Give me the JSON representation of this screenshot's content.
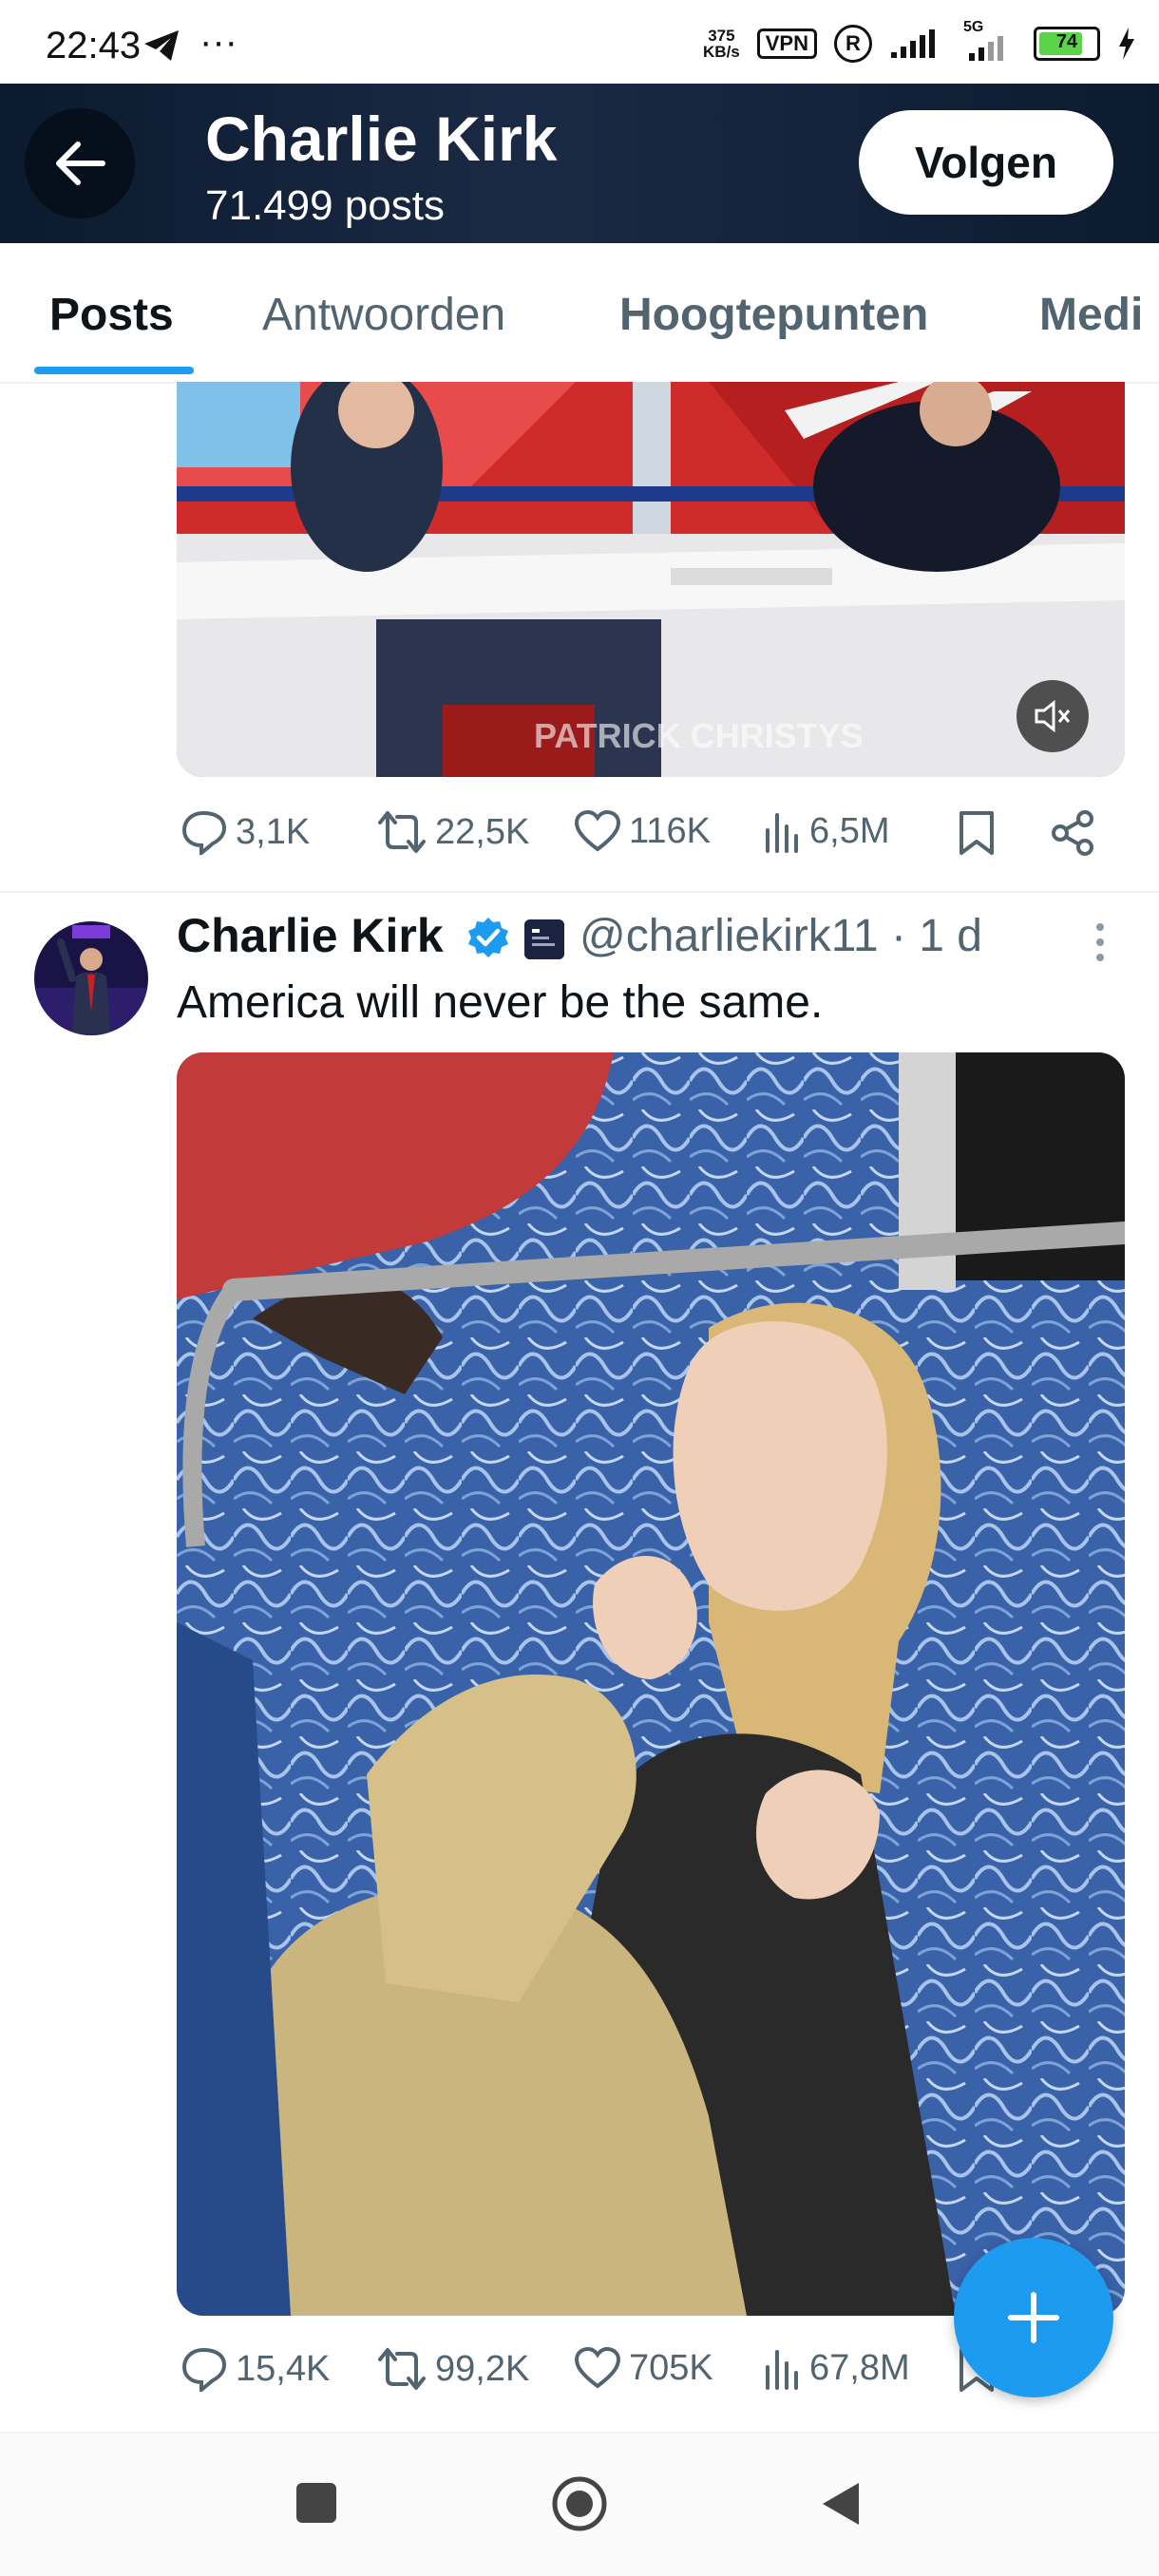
{
  "status_bar": {
    "time": "22:43",
    "more": "···",
    "net_speed_value": "375",
    "net_speed_unit": "KB/s",
    "vpn": "VPN",
    "r_label": "R",
    "signal2_label": "5G",
    "battery": "74"
  },
  "header": {
    "name": "Charlie Kirk",
    "post_count": "71.499 posts",
    "follow_label": "Volgen"
  },
  "tabs": [
    {
      "label": "Posts",
      "active": true
    },
    {
      "label": "Antwoorden",
      "active": false
    },
    {
      "label": "Hoogtepunten",
      "active": false
    },
    {
      "label": "Medi",
      "active": false
    }
  ],
  "post1": {
    "media_caption": "PATRICK CHRISTYS",
    "stats": {
      "replies": "3,1K",
      "reposts": "22,5K",
      "likes": "116K",
      "views": "6,5M"
    }
  },
  "post2": {
    "author": "Charlie Kirk",
    "handle": "@charliekirk11",
    "time": "· 1 d",
    "text": "America will never be the same.",
    "stats": {
      "replies": "15,4K",
      "reposts": "99,2K",
      "likes": "705K",
      "views": "67,8M"
    }
  },
  "colors": {
    "accent": "#1d9bf0",
    "header_bg": "#0b1a2e",
    "muted": "#536471"
  }
}
